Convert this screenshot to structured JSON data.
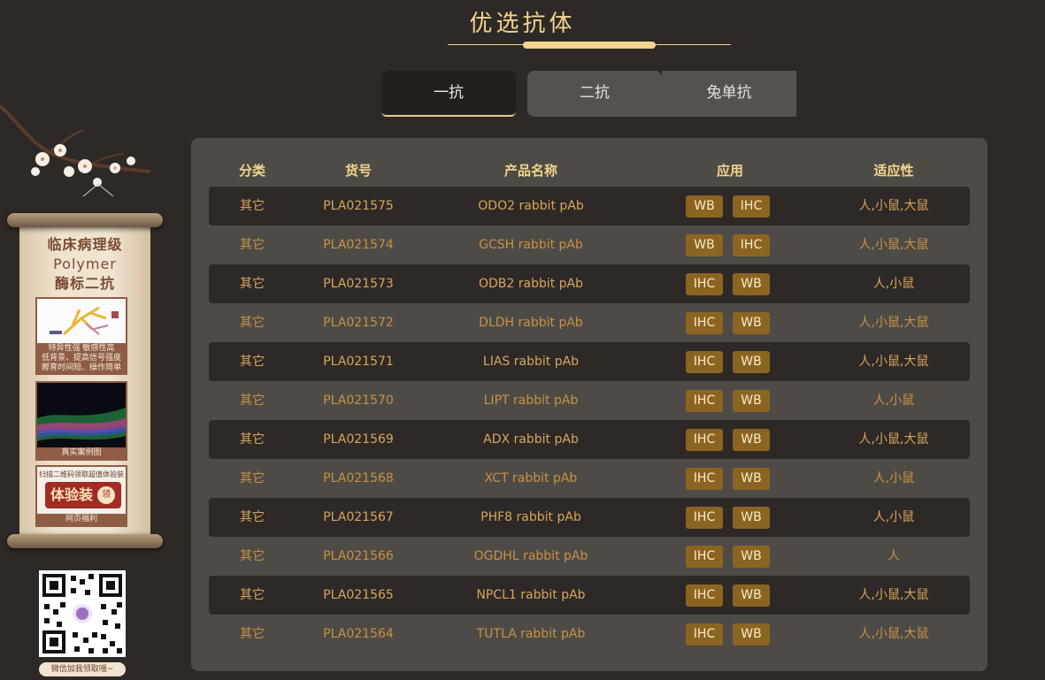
{
  "header": {
    "title": "优选抗体"
  },
  "tabs": [
    {
      "label": "一抗",
      "active": true
    },
    {
      "label": "二抗",
      "active": false
    },
    {
      "label": "兔单抗",
      "active": false
    }
  ],
  "table": {
    "columns": [
      "分类",
      "货号",
      "产品名称",
      "应用",
      "适应性"
    ],
    "rows": [
      {
        "category": "其它",
        "sku": "PLA021575",
        "name": "ODO2 rabbit pAb",
        "apps": [
          "WB",
          "IHC"
        ],
        "species": "人,小鼠,大鼠"
      },
      {
        "category": "其它",
        "sku": "PLA021574",
        "name": "GCSH rabbit pAb",
        "apps": [
          "WB",
          "IHC"
        ],
        "species": "人,小鼠,大鼠"
      },
      {
        "category": "其它",
        "sku": "PLA021573",
        "name": "ODB2 rabbit pAb",
        "apps": [
          "IHC",
          "WB"
        ],
        "species": "人,小鼠"
      },
      {
        "category": "其它",
        "sku": "PLA021572",
        "name": "DLDH rabbit pAb",
        "apps": [
          "IHC",
          "WB"
        ],
        "species": "人,小鼠,大鼠"
      },
      {
        "category": "其它",
        "sku": "PLA021571",
        "name": "LIAS rabbit pAb",
        "apps": [
          "IHC",
          "WB"
        ],
        "species": "人,小鼠,大鼠"
      },
      {
        "category": "其它",
        "sku": "PLA021570",
        "name": "LIPT rabbit pAb",
        "apps": [
          "IHC",
          "WB"
        ],
        "species": "人,小鼠"
      },
      {
        "category": "其它",
        "sku": "PLA021569",
        "name": "ADX rabbit pAb",
        "apps": [
          "IHC",
          "WB"
        ],
        "species": "人,小鼠,大鼠"
      },
      {
        "category": "其它",
        "sku": "PLA021568",
        "name": "XCT rabbit pAb",
        "apps": [
          "IHC",
          "WB"
        ],
        "species": "人,小鼠"
      },
      {
        "category": "其它",
        "sku": "PLA021567",
        "name": "PHF8 rabbit pAb",
        "apps": [
          "IHC",
          "WB"
        ],
        "species": "人,小鼠"
      },
      {
        "category": "其它",
        "sku": "PLA021566",
        "name": "OGDHL rabbit pAb",
        "apps": [
          "IHC",
          "WB"
        ],
        "species": "人"
      },
      {
        "category": "其它",
        "sku": "PLA021565",
        "name": "NPCL1 rabbit pAb",
        "apps": [
          "IHC",
          "WB"
        ],
        "species": "人,小鼠,大鼠"
      },
      {
        "category": "其它",
        "sku": "PLA021564",
        "name": "TUTLA rabbit pAb",
        "apps": [
          "IHC",
          "WB"
        ],
        "species": "人,小鼠,大鼠"
      }
    ]
  },
  "sidebar_ad": {
    "title_line1": "临床病理级",
    "title_line2": "Polymer",
    "title_line3": "酶标二抗",
    "feature_caption_line1": "特异性强 敏感性高",
    "feature_caption_line2": "低背景、提高信号强度",
    "feature_caption_line3": "孵育时间短、操作简单",
    "case_caption": "真实案例图",
    "trial_top": "扫描二维码领取超值体验装",
    "trial_label": "体验装",
    "trial_badge": "领",
    "trial_caption": "网页福利",
    "qr_caption": "微信加我领取哦~"
  },
  "colors": {
    "background": "#2e2926",
    "panel": "#4e4b46",
    "accent_gold": "#f3d58e",
    "badge": "#8c6422",
    "row_text": "#d49a4f"
  }
}
